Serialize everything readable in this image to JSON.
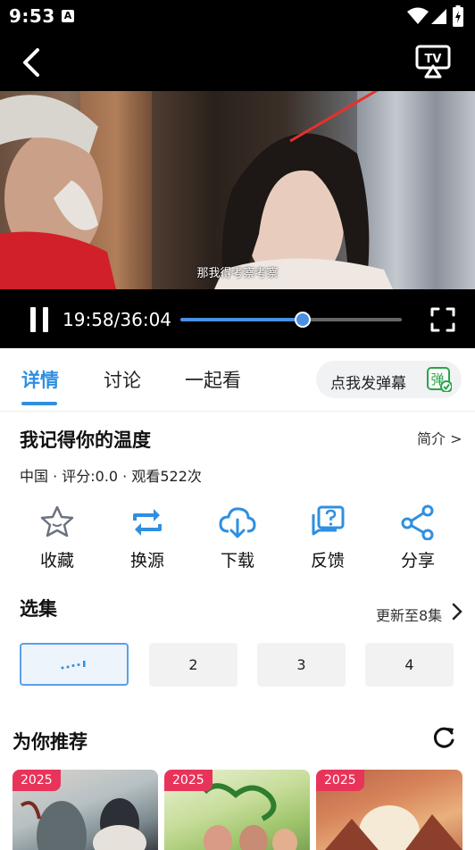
{
  "status_bar": {
    "time": "9:53",
    "notification_badge": "A",
    "icons": [
      "wifi-icon",
      "signal-icon",
      "battery-icon"
    ]
  },
  "header": {
    "back_icon": "chevron-left-icon",
    "cast_icon": "tv-cast-icon",
    "annotation": "red-arrow-pointing-to-tv-icon"
  },
  "player": {
    "subtitle": "那我得考察考察",
    "current_time": "19:58",
    "duration": "36:04",
    "timecode": "19:58/36:04",
    "progress": 0.553,
    "accent_color": "#4a90e2"
  },
  "tabs": [
    {
      "label": "详情",
      "active": true
    },
    {
      "label": "讨论",
      "active": false
    },
    {
      "label": "一起看",
      "active": false
    }
  ],
  "danmaku": {
    "label": "点我发弹幕",
    "icon_text": "弹"
  },
  "info": {
    "title": "我记得你的温度",
    "intro_link": "简介 >",
    "meta": "中国 · 评分:0.0 · 观看522次"
  },
  "actions": [
    {
      "label": "收藏",
      "icon": "star-icon"
    },
    {
      "label": "换源",
      "icon": "swap-icon"
    },
    {
      "label": "下载",
      "icon": "cloud-download-icon"
    },
    {
      "label": "反馈",
      "icon": "feedback-icon"
    },
    {
      "label": "分享",
      "icon": "share-icon"
    }
  ],
  "episodes": {
    "title": "选集",
    "update_text": "更新至8集",
    "items": [
      "",
      "2",
      "3",
      "4"
    ],
    "active_index": 0
  },
  "recommend": {
    "title": "为你推荐",
    "items": [
      {
        "badge": "2025"
      },
      {
        "badge": "2025"
      },
      {
        "badge": "2025"
      }
    ]
  }
}
